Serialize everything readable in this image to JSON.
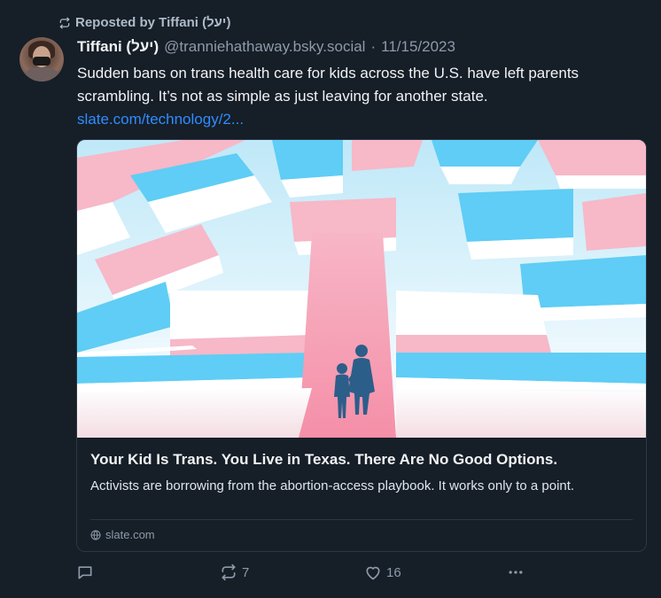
{
  "repost": {
    "label": "Reposted by Tiffani (יעל)"
  },
  "author": {
    "display_name": "Tiffani (יעל)",
    "handle": "@tranniehathaway.bsky.social",
    "separator": "·",
    "date": "11/15/2023"
  },
  "post": {
    "text": "Sudden bans on trans health care for kids across the U.S. have left parents scrambling. It’s not as simple as just leaving for another state.",
    "link_text": "slate.com/technology/2..."
  },
  "card": {
    "title": "Your Kid Is Trans. You Live in Texas. There Are No Good Options.",
    "description": "Activists are borrowing from the abortion-access playbook. It works only to a point.",
    "domain": "slate.com"
  },
  "actions": {
    "reply_count": "",
    "repost_count": "7",
    "like_count": "16"
  },
  "colors": {
    "background": "#161e27",
    "accent_link": "#2f8cff",
    "muted": "#8d9aab",
    "trans_blue": "#5bcefa",
    "trans_pink": "#f5a9b8",
    "white": "#ffffff"
  },
  "icons": [
    "repost-icon",
    "globe-icon",
    "reply-icon",
    "like-icon",
    "more-icon"
  ]
}
